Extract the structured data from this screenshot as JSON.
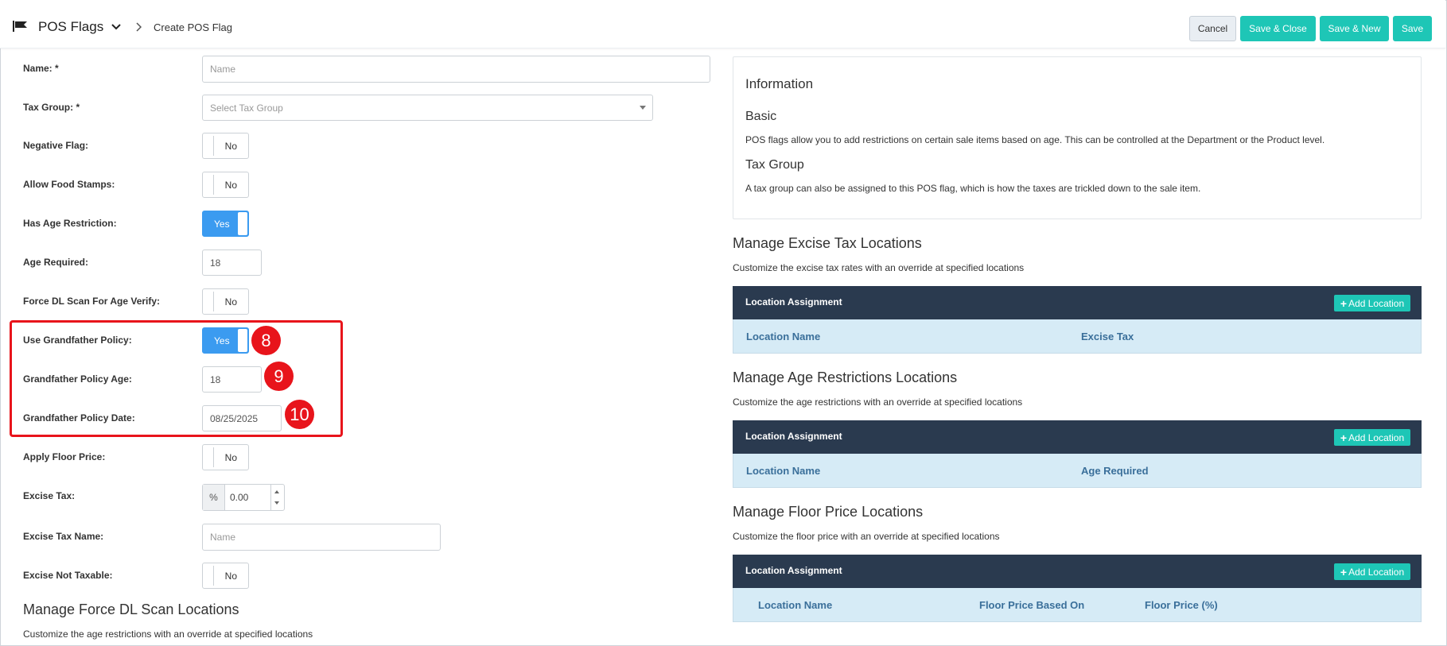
{
  "header": {
    "app_title": "POS Flags",
    "breadcrumb_current": "Create POS Flag",
    "buttons": {
      "cancel": "Cancel",
      "save_close": "Save & Close",
      "save_new": "Save & New",
      "save": "Save"
    }
  },
  "form": {
    "name": {
      "label": "Name: *",
      "placeholder": "Name"
    },
    "tax_group": {
      "label": "Tax Group: *",
      "placeholder": "Select Tax Group"
    },
    "negative_flag": {
      "label": "Negative Flag:",
      "value": "No"
    },
    "allow_food_stamps": {
      "label": "Allow Food Stamps:",
      "value": "No"
    },
    "has_age_restriction": {
      "label": "Has Age Restriction:",
      "value": "Yes"
    },
    "age_required": {
      "label": "Age Required:",
      "value": "18"
    },
    "force_dl_scan": {
      "label": "Force DL Scan For Age Verify:",
      "value": "No"
    },
    "use_grandfather_policy": {
      "label": "Use Grandfather Policy:",
      "value": "Yes"
    },
    "grandfather_policy_age": {
      "label": "Grandfather Policy Age:",
      "value": "18"
    },
    "grandfather_policy_date": {
      "label": "Grandfather Policy Date:",
      "value": "08/25/2025"
    },
    "apply_floor_price": {
      "label": "Apply Floor Price:",
      "value": "No"
    },
    "excise_tax": {
      "label": "Excise Tax:",
      "unit": "%",
      "value": "0.00"
    },
    "excise_tax_name": {
      "label": "Excise Tax Name:",
      "placeholder": "Name"
    },
    "excise_not_taxable": {
      "label": "Excise Not Taxable:",
      "value": "No"
    }
  },
  "badges": {
    "b8": "8",
    "b9": "9",
    "b10": "10"
  },
  "force_dl_section": {
    "title": "Manage Force DL Scan Locations",
    "desc": "Customize the age restrictions with an override at specified locations"
  },
  "info": {
    "title": "Information",
    "basic_heading": "Basic",
    "basic_text": "POS flags allow you to add restrictions on certain sale items based on age. This can be controlled at the Department or the Product level.",
    "tax_heading": "Tax Group",
    "tax_text": "A tax group can also be assigned to this POS flag, which is how the taxes are trickled down to the sale item."
  },
  "excise_section": {
    "title": "Manage Excise Tax Locations",
    "desc": "Customize the excise tax rates with an override at specified locations",
    "table_title": "Location Assignment",
    "add_label": "Add Location",
    "columns": [
      "Location Name",
      "Excise Tax"
    ]
  },
  "age_section": {
    "title": "Manage Age Restrictions Locations",
    "desc": "Customize the age restrictions with an override at specified locations",
    "table_title": "Location Assignment",
    "add_label": "Add Location",
    "columns": [
      "Location Name",
      "Age Required"
    ]
  },
  "floor_section": {
    "title": "Manage Floor Price Locations",
    "desc": "Customize the floor price with an override at specified locations",
    "table_title": "Location Assignment",
    "add_label": "Add Location",
    "columns": [
      "Location Name",
      "Floor Price Based On",
      "Floor Price (%)"
    ]
  },
  "colors": {
    "accent": "#1ec6b6",
    "toggle_on": "#3b9bf0",
    "table_header": "#2a3a4f",
    "highlight": "#e8141b"
  }
}
